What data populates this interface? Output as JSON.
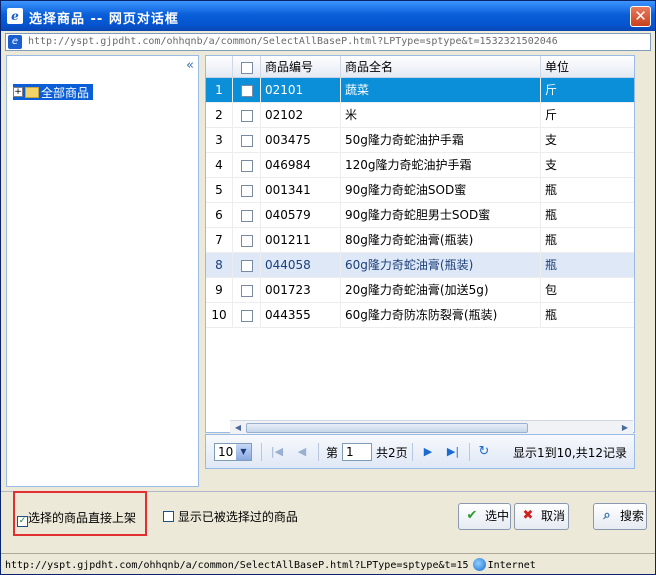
{
  "window": {
    "title": "选择商品  --  网页对话框",
    "address": "http://yspt.gjpdht.com/ohhqnb/a/common/SelectAllBaseP.html?LPType=sptype&t=1532321502046"
  },
  "tree": {
    "root_label": "全部商品"
  },
  "grid": {
    "columns": [
      "商品编号",
      "商品全名",
      "单位"
    ],
    "rows": [
      {
        "n": "1",
        "code": "02101",
        "name": "蔬菜",
        "unit": "斤"
      },
      {
        "n": "2",
        "code": "02102",
        "name": "米",
        "unit": "斤"
      },
      {
        "n": "3",
        "code": "003475",
        "name": "50g隆力奇蛇油护手霜",
        "unit": "支"
      },
      {
        "n": "4",
        "code": "046984",
        "name": "120g隆力奇蛇油护手霜",
        "unit": "支"
      },
      {
        "n": "5",
        "code": "001341",
        "name": "90g隆力奇蛇油SOD蜜",
        "unit": "瓶"
      },
      {
        "n": "6",
        "code": "040579",
        "name": "90g隆力奇蛇胆男士SOD蜜",
        "unit": "瓶"
      },
      {
        "n": "7",
        "code": "001211",
        "name": "80g隆力奇蛇油膏(瓶装)",
        "unit": "瓶"
      },
      {
        "n": "8",
        "code": "044058",
        "name": "60g隆力奇蛇油膏(瓶装)",
        "unit": "瓶"
      },
      {
        "n": "9",
        "code": "001723",
        "name": "20g隆力奇蛇油膏(加送5g)",
        "unit": "包"
      },
      {
        "n": "10",
        "code": "044355",
        "name": "60g隆力奇防冻防裂膏(瓶装)",
        "unit": "瓶"
      }
    ],
    "selected_row": "1",
    "hover_row": "8"
  },
  "pager": {
    "page_size": "10",
    "page_prefix": "第",
    "current_page": "1",
    "total_pages": "共2页",
    "summary": "显示1到10,共12记录"
  },
  "options": {
    "direct_shelf_label": "选择的商品直接上架",
    "direct_shelf_checked": true,
    "show_selected_label": "显示已被选择过的商品",
    "show_selected_checked": false
  },
  "buttons": {
    "select": "选中",
    "cancel": "取消",
    "search": "搜索"
  },
  "status": {
    "url": "http://yspt.gjpdht.com/ohhqnb/a/common/SelectAllBaseP.html?LPType=sptype&t=15",
    "zone": "Internet"
  }
}
